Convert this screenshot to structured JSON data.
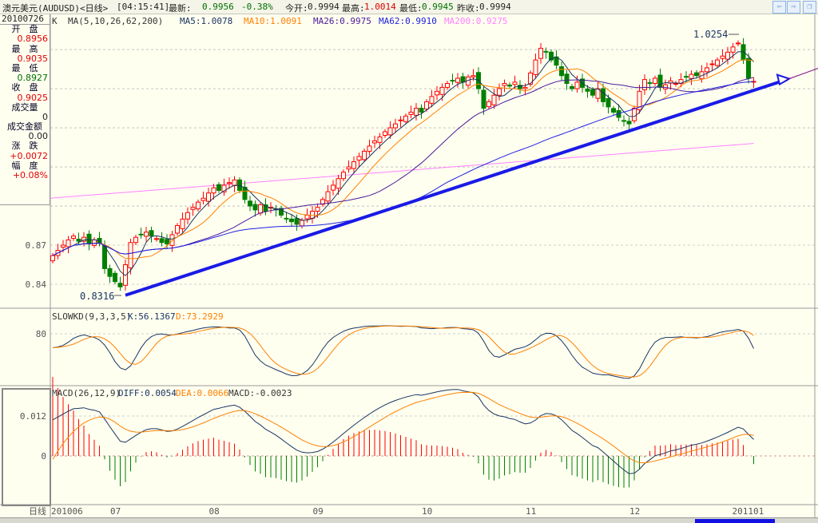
{
  "header": {
    "symbol": "澳元美元(AUDUSD)<日线>",
    "time": "[04:15:41]",
    "latest_label": "最新:",
    "latest": "0.9956",
    "change_pct": "-0.38%",
    "open_label": "今开:",
    "open": "0.9994",
    "high_label": "最高:",
    "high": "1.0014",
    "low_label": "最低:",
    "low": "0.9945",
    "prev_close_label": "昨收:",
    "prev_close": "0.9994",
    "buttons": [
      {
        "name": "prev",
        "icon": "arrow-left-icon",
        "glyph": "⇦"
      },
      {
        "name": "next",
        "icon": "arrow-right-icon",
        "glyph": "⇨"
      },
      {
        "name": "restore",
        "icon": "restore-window-icon",
        "glyph": "❐"
      }
    ]
  },
  "info_panel": {
    "date": "20100726",
    "open_label": "开　盘",
    "open": "0.8956",
    "high_label": "最　高",
    "high": "0.9035",
    "low_label": "最　低",
    "low": "0.8927",
    "close_label": "收　盘",
    "close": "0.9025",
    "volume_label": "成交量",
    "volume": "0",
    "amount_label": "成交金额",
    "amount": "0.00",
    "change_label": "涨　跌",
    "change": "+0.0072",
    "range_label": "幅　度",
    "range": "+0.08%"
  },
  "ma_legend": {
    "k": "K",
    "params": "MA(5,10,26,62,200)",
    "ma5": "MA5:1.0078",
    "ma10": "MA10:1.0091",
    "ma26": "MA26:0.9975",
    "ma62": "MA62:0.9910",
    "ma200": "MA200:0.9275"
  },
  "kd_legend": {
    "params": "SLOWKD(9,3,3,5)",
    "k": "K:56.1367",
    "d": "D:73.2929"
  },
  "macd_legend": {
    "params": "MACD(26,12,9)",
    "diff": "DIFF:0.0054",
    "dea": "DEA:0.0066",
    "macd": "MACD:-0.0023"
  },
  "colors": {
    "up": "#ff0000",
    "down": "#008000",
    "ma5": "#1a3560",
    "ma10": "#ff8000",
    "ma26": "#4a1a9a",
    "ma62": "#2020e0",
    "ma200": "#ff80ff",
    "trend": "#1a1ae6",
    "k": "#1a3560",
    "d": "#ff8000",
    "grid": "#a0a0a0"
  },
  "chart_data": {
    "type": "candlestick",
    "period": "日线",
    "x_tick_labels": [
      "201006",
      "07",
      "08",
      "09",
      "10",
      "11",
      "12",
      "201101"
    ],
    "y_tick_labels": [
      "0.84",
      "0.87"
    ],
    "ylim": [
      0.82,
      1.04
    ],
    "grid": "horizontal dashed",
    "close": [
      0.862,
      0.866,
      0.87,
      0.874,
      0.877,
      0.873,
      0.876,
      0.871,
      0.874,
      0.872,
      0.852,
      0.846,
      0.842,
      0.838,
      0.855,
      0.872,
      0.876,
      0.878,
      0.88,
      0.877,
      0.875,
      0.872,
      0.871,
      0.878,
      0.885,
      0.89,
      0.895,
      0.899,
      0.903,
      0.906,
      0.91,
      0.914,
      0.912,
      0.916,
      0.918,
      0.92,
      0.912,
      0.905,
      0.9,
      0.897,
      0.901,
      0.896,
      0.899,
      0.897,
      0.893,
      0.89,
      0.888,
      0.886,
      0.889,
      0.893,
      0.896,
      0.899,
      0.905,
      0.911,
      0.916,
      0.921,
      0.926,
      0.93,
      0.934,
      0.938,
      0.942,
      0.946,
      0.95,
      0.953,
      0.957,
      0.96,
      0.963,
      0.966,
      0.969,
      0.972,
      0.975,
      0.972,
      0.98,
      0.984,
      0.988,
      0.991,
      0.994,
      0.996,
      0.998,
      0.995,
      0.999,
      1.0,
      0.99,
      0.975,
      0.98,
      0.985,
      0.99,
      0.994,
      0.992,
      0.995,
      0.99,
      0.991,
      1.002,
      1.012,
      1.021,
      1.018,
      1.012,
      1.008,
      1.0,
      0.994,
      0.99,
      0.995,
      0.991,
      0.988,
      0.985,
      0.99,
      0.98,
      0.976,
      0.972,
      0.968,
      0.965,
      0.963,
      0.975,
      0.988,
      0.997,
      0.994,
      0.998,
      0.991,
      0.993,
      0.996,
      0.994,
      0.997,
      0.999,
      1.001,
      1.0,
      1.003,
      1.006,
      1.009,
      1.012,
      1.015,
      1.018,
      1.022,
      1.025,
      1.012,
      0.998,
      0.9956
    ],
    "ma200_range": [
      0.903,
      0.948
    ],
    "annotations": {
      "low": "0.8316",
      "high": "1.0254"
    },
    "trendline": {
      "from_price": 0.8316,
      "to_price": 0.997
    },
    "kd": {
      "y_tick_labels": [
        "80"
      ],
      "ylim": [
        0,
        100
      ]
    },
    "macd": {
      "y_tick_labels": [
        "0.012",
        "0"
      ]
    }
  }
}
